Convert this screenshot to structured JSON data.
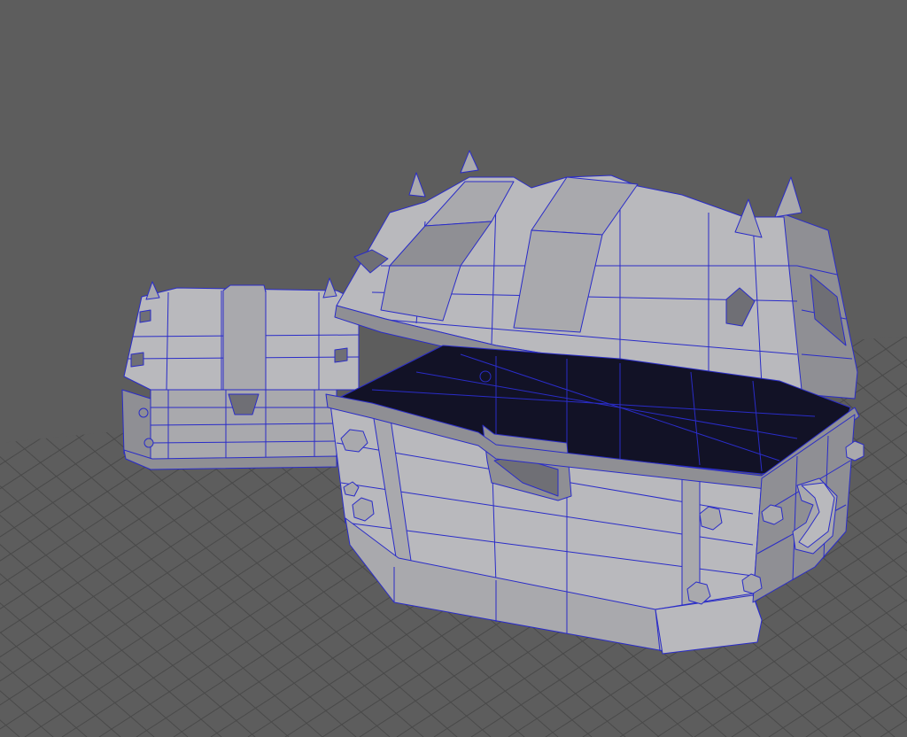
{
  "viewport": {
    "background_color": "#5d5d5d",
    "grid_color": "#4a4a4a",
    "wireframe_color": "#2a2cc8",
    "surface_color": "#b9b9bd",
    "interior_color": "#121226",
    "objects": [
      {
        "id": "small-chest",
        "state": "closed"
      },
      {
        "id": "large-chest",
        "state": "open"
      }
    ]
  }
}
